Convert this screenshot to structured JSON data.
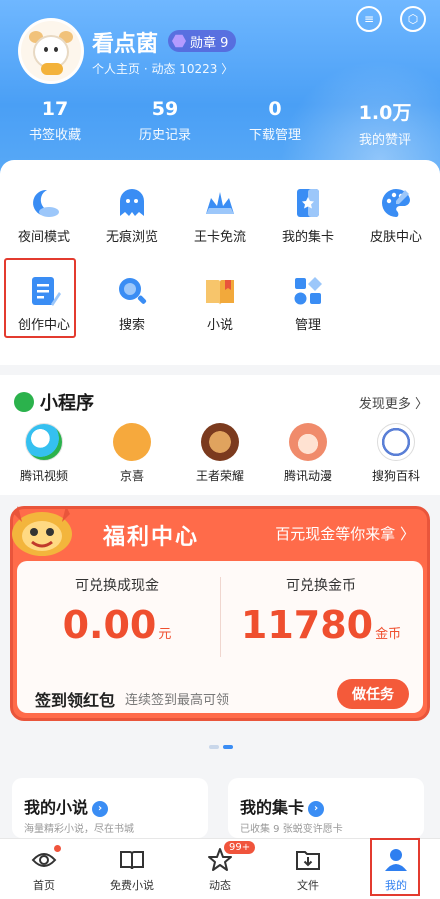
{
  "header": {
    "username": "看点菌",
    "badge_label": "勋章 9",
    "profile_link": "个人主页 · 动态 10223 〉",
    "stats": [
      {
        "value": "17",
        "label": "书签收藏"
      },
      {
        "value": "59",
        "label": "历史记录"
      },
      {
        "value": "0",
        "label": "下载管理"
      },
      {
        "value": "1.0万",
        "label": "我的赞评"
      }
    ]
  },
  "grid": {
    "row1": [
      {
        "label": "夜间模式",
        "icon": "night-mode-icon",
        "color": "#3a8df4"
      },
      {
        "label": "无痕浏览",
        "icon": "ghost-icon",
        "color": "#3a8df4"
      },
      {
        "label": "王卡免流",
        "icon": "crown-icon",
        "color": "#3a8df4"
      },
      {
        "label": "我的集卡",
        "icon": "card-collection-icon",
        "color": "#3a8df4"
      },
      {
        "label": "皮肤中心",
        "icon": "palette-icon",
        "color": "#3a8df4"
      }
    ],
    "row2": [
      {
        "label": "创作中心",
        "icon": "document-edit-icon",
        "color": "#3a8df4"
      },
      {
        "label": "搜索",
        "icon": "search-icon",
        "color": "#3a8df4"
      },
      {
        "label": "小说",
        "icon": "book-icon",
        "color": "#f2a93b"
      },
      {
        "label": "管理",
        "icon": "manage-icon",
        "color": "#3a8df4"
      }
    ]
  },
  "mini_programs": {
    "title": "小程序",
    "more": "发现更多 〉",
    "apps": [
      {
        "label": "腾讯视频",
        "icon": "tencent-video-icon",
        "color": "#35c0f0"
      },
      {
        "label": "京喜",
        "icon": "jingxi-icon",
        "color": "#f6a93d"
      },
      {
        "label": "王者荣耀",
        "icon": "honor-of-kings-icon",
        "color": "#c9733b"
      },
      {
        "label": "腾讯动漫",
        "icon": "tencent-comics-icon",
        "color": "#f08b6b"
      },
      {
        "label": "搜狗百科",
        "icon": "sogou-baike-icon",
        "color": "#5a7fd6"
      }
    ]
  },
  "welfare": {
    "title": "福利中心",
    "promo": "百元现金等你来拿 〉",
    "cash_label": "可兑换成现金",
    "cash_value": "0.00",
    "cash_unit": "元",
    "coin_label": "可兑换金币",
    "coin_value": "11780",
    "coin_unit": "金币",
    "sign_title": "签到领红包",
    "sign_sub": "连续签到最高可领",
    "task_button": "做任务"
  },
  "bottom_cards": [
    {
      "title": "我的小说",
      "sub": "海量精彩小说，尽在书城"
    },
    {
      "title": "我的集卡",
      "sub": "已收集 9 张蜕变许愿卡"
    }
  ],
  "tabbar": [
    {
      "label": "首页",
      "icon": "eye-icon"
    },
    {
      "label": "免费小说",
      "icon": "open-book-icon"
    },
    {
      "label": "动态",
      "icon": "star-icon",
      "badge": "99+"
    },
    {
      "label": "文件",
      "icon": "folder-download-icon"
    },
    {
      "label": "我的",
      "icon": "profile-icon"
    }
  ],
  "colors": {
    "accent": "#3a8df4",
    "welfare": "#ff6b4a",
    "highlight": "#e33b2f"
  }
}
